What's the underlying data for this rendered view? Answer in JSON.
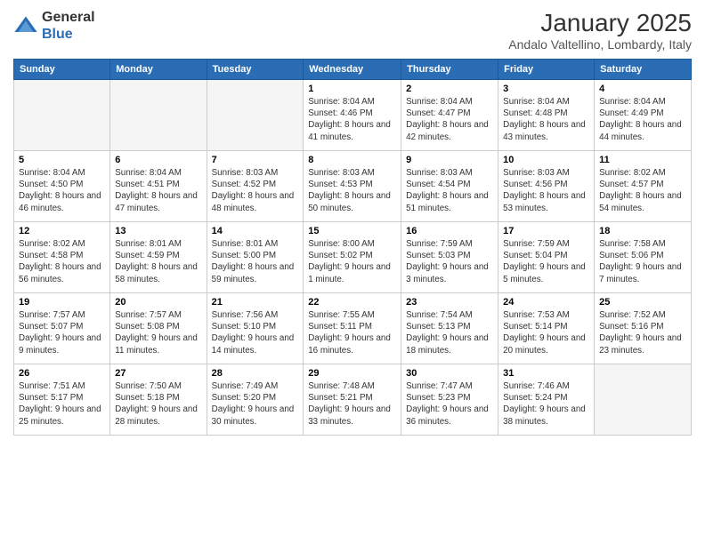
{
  "header": {
    "logo_line1": "General",
    "logo_line2": "Blue",
    "month": "January 2025",
    "location": "Andalo Valtellino, Lombardy, Italy"
  },
  "weekdays": [
    "Sunday",
    "Monday",
    "Tuesday",
    "Wednesday",
    "Thursday",
    "Friday",
    "Saturday"
  ],
  "weeks": [
    [
      {
        "day": "",
        "info": ""
      },
      {
        "day": "",
        "info": ""
      },
      {
        "day": "",
        "info": ""
      },
      {
        "day": "1",
        "info": "Sunrise: 8:04 AM\nSunset: 4:46 PM\nDaylight: 8 hours and 41 minutes."
      },
      {
        "day": "2",
        "info": "Sunrise: 8:04 AM\nSunset: 4:47 PM\nDaylight: 8 hours and 42 minutes."
      },
      {
        "day": "3",
        "info": "Sunrise: 8:04 AM\nSunset: 4:48 PM\nDaylight: 8 hours and 43 minutes."
      },
      {
        "day": "4",
        "info": "Sunrise: 8:04 AM\nSunset: 4:49 PM\nDaylight: 8 hours and 44 minutes."
      }
    ],
    [
      {
        "day": "5",
        "info": "Sunrise: 8:04 AM\nSunset: 4:50 PM\nDaylight: 8 hours and 46 minutes."
      },
      {
        "day": "6",
        "info": "Sunrise: 8:04 AM\nSunset: 4:51 PM\nDaylight: 8 hours and 47 minutes."
      },
      {
        "day": "7",
        "info": "Sunrise: 8:03 AM\nSunset: 4:52 PM\nDaylight: 8 hours and 48 minutes."
      },
      {
        "day": "8",
        "info": "Sunrise: 8:03 AM\nSunset: 4:53 PM\nDaylight: 8 hours and 50 minutes."
      },
      {
        "day": "9",
        "info": "Sunrise: 8:03 AM\nSunset: 4:54 PM\nDaylight: 8 hours and 51 minutes."
      },
      {
        "day": "10",
        "info": "Sunrise: 8:03 AM\nSunset: 4:56 PM\nDaylight: 8 hours and 53 minutes."
      },
      {
        "day": "11",
        "info": "Sunrise: 8:02 AM\nSunset: 4:57 PM\nDaylight: 8 hours and 54 minutes."
      }
    ],
    [
      {
        "day": "12",
        "info": "Sunrise: 8:02 AM\nSunset: 4:58 PM\nDaylight: 8 hours and 56 minutes."
      },
      {
        "day": "13",
        "info": "Sunrise: 8:01 AM\nSunset: 4:59 PM\nDaylight: 8 hours and 58 minutes."
      },
      {
        "day": "14",
        "info": "Sunrise: 8:01 AM\nSunset: 5:00 PM\nDaylight: 8 hours and 59 minutes."
      },
      {
        "day": "15",
        "info": "Sunrise: 8:00 AM\nSunset: 5:02 PM\nDaylight: 9 hours and 1 minute."
      },
      {
        "day": "16",
        "info": "Sunrise: 7:59 AM\nSunset: 5:03 PM\nDaylight: 9 hours and 3 minutes."
      },
      {
        "day": "17",
        "info": "Sunrise: 7:59 AM\nSunset: 5:04 PM\nDaylight: 9 hours and 5 minutes."
      },
      {
        "day": "18",
        "info": "Sunrise: 7:58 AM\nSunset: 5:06 PM\nDaylight: 9 hours and 7 minutes."
      }
    ],
    [
      {
        "day": "19",
        "info": "Sunrise: 7:57 AM\nSunset: 5:07 PM\nDaylight: 9 hours and 9 minutes."
      },
      {
        "day": "20",
        "info": "Sunrise: 7:57 AM\nSunset: 5:08 PM\nDaylight: 9 hours and 11 minutes."
      },
      {
        "day": "21",
        "info": "Sunrise: 7:56 AM\nSunset: 5:10 PM\nDaylight: 9 hours and 14 minutes."
      },
      {
        "day": "22",
        "info": "Sunrise: 7:55 AM\nSunset: 5:11 PM\nDaylight: 9 hours and 16 minutes."
      },
      {
        "day": "23",
        "info": "Sunrise: 7:54 AM\nSunset: 5:13 PM\nDaylight: 9 hours and 18 minutes."
      },
      {
        "day": "24",
        "info": "Sunrise: 7:53 AM\nSunset: 5:14 PM\nDaylight: 9 hours and 20 minutes."
      },
      {
        "day": "25",
        "info": "Sunrise: 7:52 AM\nSunset: 5:16 PM\nDaylight: 9 hours and 23 minutes."
      }
    ],
    [
      {
        "day": "26",
        "info": "Sunrise: 7:51 AM\nSunset: 5:17 PM\nDaylight: 9 hours and 25 minutes."
      },
      {
        "day": "27",
        "info": "Sunrise: 7:50 AM\nSunset: 5:18 PM\nDaylight: 9 hours and 28 minutes."
      },
      {
        "day": "28",
        "info": "Sunrise: 7:49 AM\nSunset: 5:20 PM\nDaylight: 9 hours and 30 minutes."
      },
      {
        "day": "29",
        "info": "Sunrise: 7:48 AM\nSunset: 5:21 PM\nDaylight: 9 hours and 33 minutes."
      },
      {
        "day": "30",
        "info": "Sunrise: 7:47 AM\nSunset: 5:23 PM\nDaylight: 9 hours and 36 minutes."
      },
      {
        "day": "31",
        "info": "Sunrise: 7:46 AM\nSunset: 5:24 PM\nDaylight: 9 hours and 38 minutes."
      },
      {
        "day": "",
        "info": ""
      }
    ]
  ]
}
